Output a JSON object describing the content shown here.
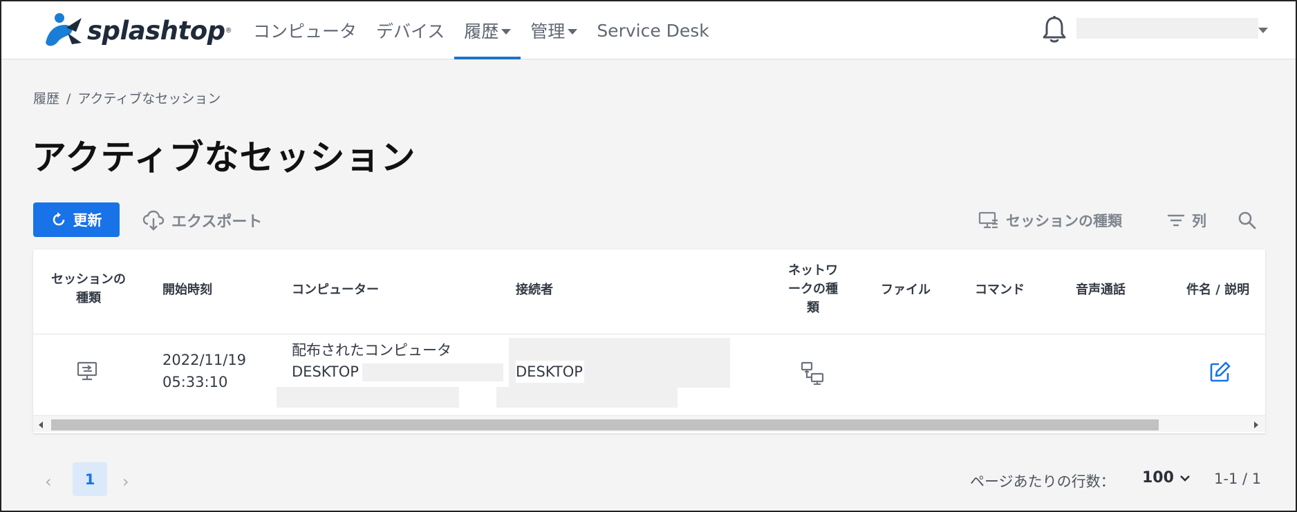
{
  "brand": {
    "name": "splashtop",
    "reg": "®"
  },
  "nav": {
    "items": [
      {
        "label": "コンピュータ",
        "dropdown": false,
        "active": false
      },
      {
        "label": "デバイス",
        "dropdown": false,
        "active": false
      },
      {
        "label": "履歴",
        "dropdown": true,
        "active": true
      },
      {
        "label": "管理",
        "dropdown": true,
        "active": false
      },
      {
        "label": "Service Desk",
        "dropdown": false,
        "active": false
      }
    ]
  },
  "header": {
    "notification_icon": "bell-icon"
  },
  "breadcrumb": {
    "parent": "履歴",
    "separator": "/",
    "current": "アクティブなセッション"
  },
  "page": {
    "title": "アクティブなセッション"
  },
  "toolbar": {
    "refresh_label": "更新",
    "export_label": "エクスポート",
    "session_type_label": "セッションの種類",
    "columns_label": "列"
  },
  "table": {
    "headers": {
      "session_type": "セッションの\n種類",
      "start_time": "開始時刻",
      "computer": "コンピューター",
      "connected_by": "接続者",
      "network_type": "ネットワ\nークの種\n類",
      "file": "ファイル",
      "command": "コマンド",
      "voice_call": "音声通話",
      "subject": "件名 / 説明"
    },
    "rows": [
      {
        "session_type_icon": "remote-desktop-icon",
        "start_date": "2022/11/19",
        "start_time": "05:33:10",
        "computer_group": "配布されたコンピュータ",
        "computer_name": "DESKTOP",
        "connected_by": "DESKTOP",
        "network_icon": "network-icon",
        "edit_icon": "edit-icon"
      }
    ]
  },
  "pagination": {
    "current_page": "1",
    "rows_per_page_label": "ページあたりの行数：",
    "rows_per_page": "100",
    "range": "1-1 / 1"
  },
  "colors": {
    "accent": "#1872e8",
    "active_underline": "#1b73c9",
    "page_bg": "#f4f4f4"
  }
}
